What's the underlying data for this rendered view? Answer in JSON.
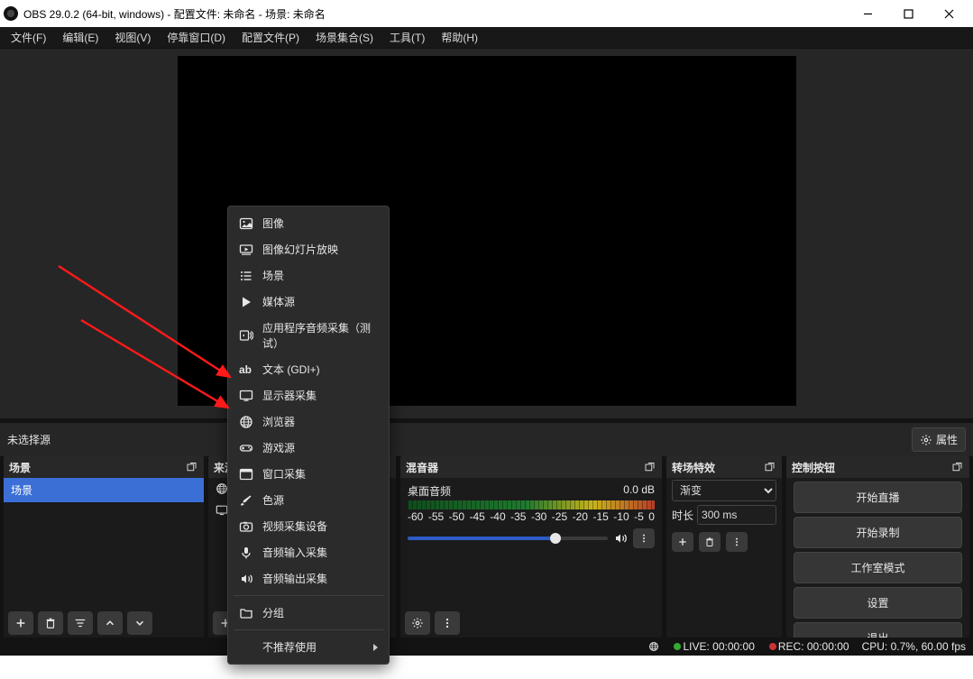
{
  "titlebar": {
    "title": "OBS 29.0.2 (64-bit, windows) - 配置文件: 未命名 - 场景: 未命名"
  },
  "menubar": [
    "文件(F)",
    "编辑(E)",
    "视图(V)",
    "停靠窗口(D)",
    "配置文件(P)",
    "场景集合(S)",
    "工具(T)",
    "帮助(H)"
  ],
  "propbar": {
    "no_selection": "未选择源",
    "properties_button": "属性"
  },
  "panels": {
    "scenes": {
      "title": "场景",
      "items": [
        "场景"
      ]
    },
    "sources": {
      "title": "来源"
    },
    "mixer": {
      "title": "混音器",
      "track_name": "桌面音频",
      "track_db": "0.0 dB",
      "ticks": [
        "-60",
        "-55",
        "-50",
        "-45",
        "-40",
        "-35",
        "-30",
        "-25",
        "-20",
        "-15",
        "-10",
        "-5",
        "0"
      ]
    },
    "transitions": {
      "title": "转场特效",
      "selected": "渐变",
      "duration_label": "时长",
      "duration_value": "300 ms"
    },
    "controls": {
      "title": "控制按钮",
      "buttons": [
        "开始直播",
        "开始录制",
        "工作室模式",
        "设置",
        "退出"
      ]
    }
  },
  "popup": {
    "items": [
      {
        "icon": "image",
        "label": "图像"
      },
      {
        "icon": "slideshow",
        "label": "图像幻灯片放映"
      },
      {
        "icon": "list",
        "label": "场景"
      },
      {
        "icon": "play",
        "label": "媒体源"
      },
      {
        "icon": "appaudio",
        "label": "应用程序音频采集（测试）"
      },
      {
        "icon": "ab",
        "label": "文本 (GDI+)"
      },
      {
        "icon": "monitor",
        "label": "显示器采集"
      },
      {
        "icon": "globe",
        "label": "浏览器"
      },
      {
        "icon": "gamepad",
        "label": "游戏源"
      },
      {
        "icon": "window",
        "label": "窗口采集"
      },
      {
        "icon": "brush",
        "label": "色源"
      },
      {
        "icon": "camera",
        "label": "视频采集设备"
      },
      {
        "icon": "mic",
        "label": "音频输入采集"
      },
      {
        "icon": "speaker",
        "label": "音频输出采集"
      }
    ],
    "group": {
      "icon": "folder",
      "label": "分组"
    },
    "deprecated": "不推荐使用"
  },
  "statusbar": {
    "live": "LIVE: 00:00:00",
    "rec": "REC: 00:00:00",
    "cpu": "CPU: 0.7%, 60.00 fps"
  }
}
